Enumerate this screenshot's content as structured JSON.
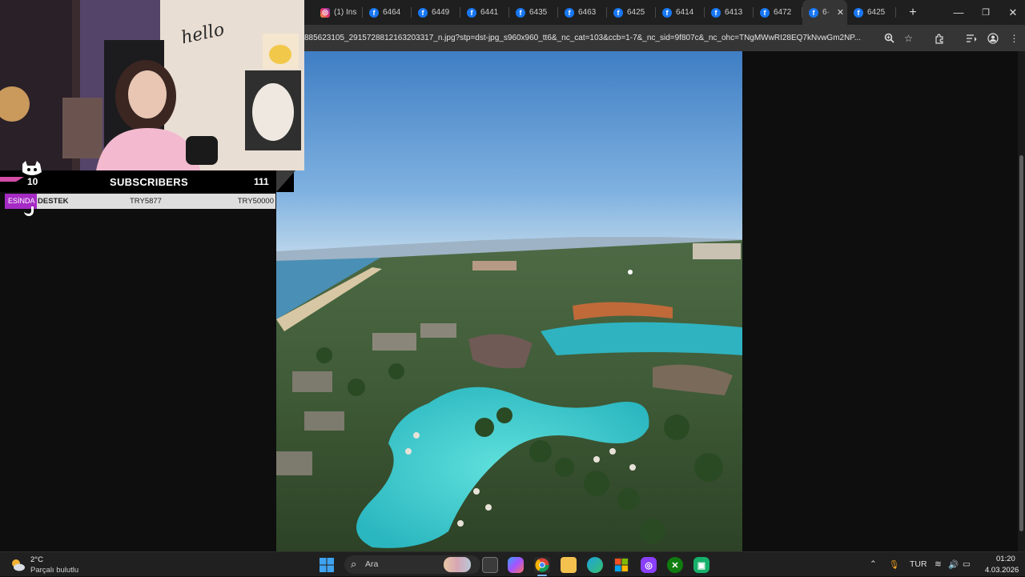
{
  "browser": {
    "tabs": [
      {
        "icon": "instagram-icon",
        "label": "(1) Ins"
      },
      {
        "icon": "facebook-icon",
        "label": "6464"
      },
      {
        "icon": "facebook-icon",
        "label": "6449"
      },
      {
        "icon": "facebook-icon",
        "label": "6441"
      },
      {
        "icon": "facebook-icon",
        "label": "6435"
      },
      {
        "icon": "facebook-icon",
        "label": "6463"
      },
      {
        "icon": "facebook-icon",
        "label": "6425"
      },
      {
        "icon": "facebook-icon",
        "label": "6414"
      },
      {
        "icon": "facebook-icon",
        "label": "6413"
      },
      {
        "icon": "facebook-icon",
        "label": "6472"
      },
      {
        "icon": "facebook-icon",
        "label": "6·",
        "active": true
      },
      {
        "icon": "facebook-icon",
        "label": "6425"
      }
    ],
    "new_tab_label": "+",
    "window_controls": {
      "minimize": "—",
      "restore": "❐",
      "close": "✕"
    },
    "url": "885623105_2915728812163203317_n.jpg?stp=dst-jpg_s960x960_tt6&_nc_cat=103&ccb=1-7&_nc_sid=9f807c&_nc_ohc=TNgMWwRI28EQ7kNvwGm2NP..."
  },
  "overlay": {
    "webcam_sign": "hello",
    "subscribers": {
      "left_count": "10",
      "title": "SUBSCRIBERS",
      "right_count": "111"
    },
    "donation": {
      "tag": "ESİNDA",
      "name": "DESTEK",
      "current": "TRY5877",
      "goal": "TRY50000"
    }
  },
  "taskbar": {
    "weather": {
      "temp": "2°C",
      "desc": "Parçalı bulutlu"
    },
    "search_placeholder": "Ara",
    "language": "TUR",
    "time": "01:20",
    "date": "4.03.2026"
  },
  "colors": {
    "donation_tag": "#a52bc4",
    "facebook": "#1877f2",
    "taskbar": "#202020"
  }
}
